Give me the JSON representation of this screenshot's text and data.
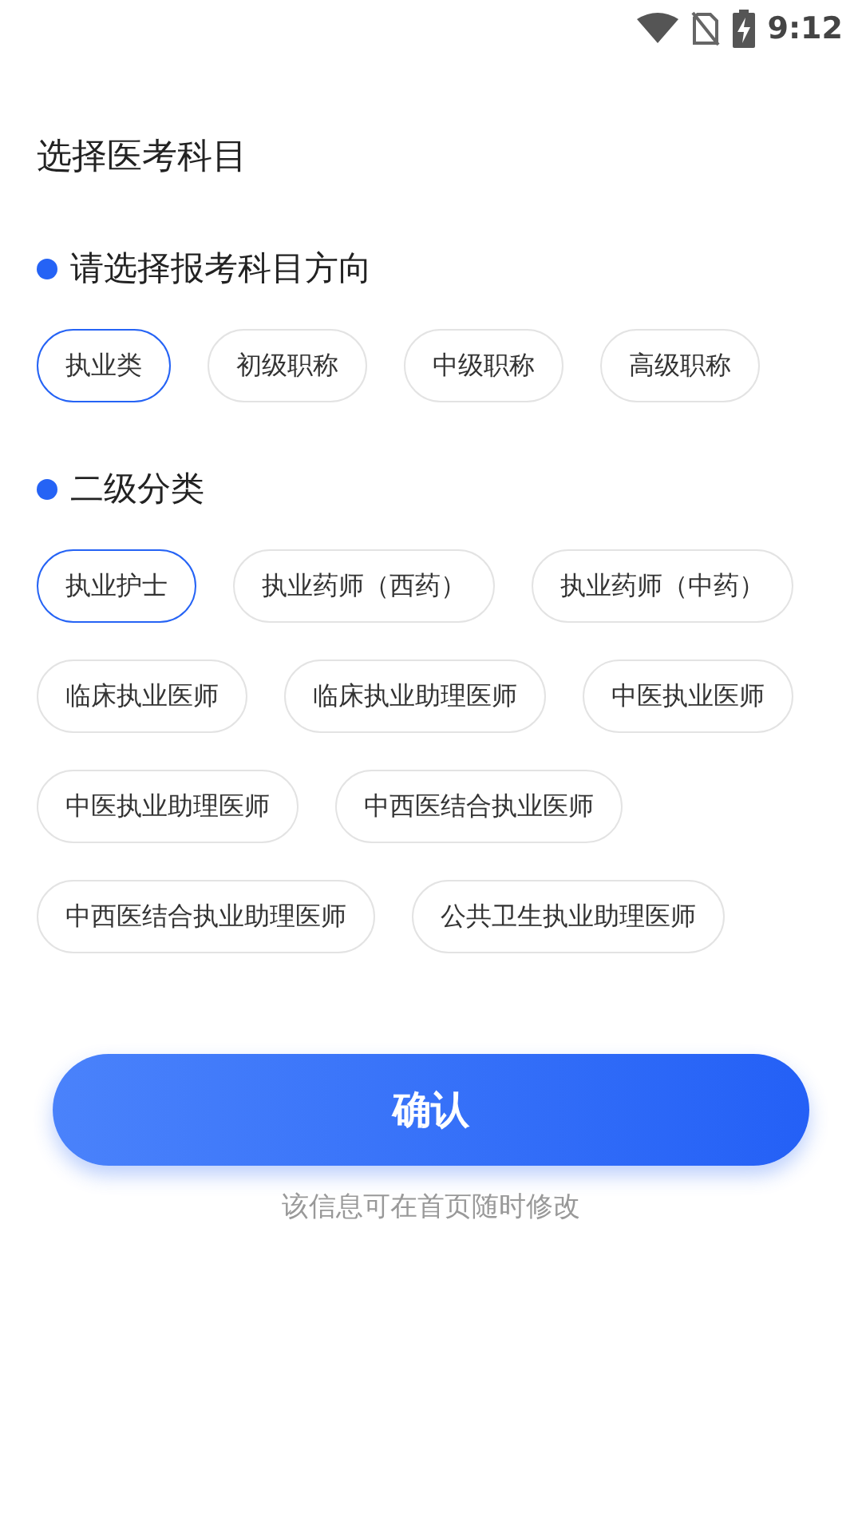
{
  "status_bar": {
    "time": "9:12"
  },
  "title": "选择医考科目",
  "sections": [
    {
      "heading": "请选择报考科目方向",
      "options": [
        {
          "label": "执业类",
          "selected": true
        },
        {
          "label": "初级职称",
          "selected": false
        },
        {
          "label": "中级职称",
          "selected": false
        },
        {
          "label": "高级职称",
          "selected": false
        }
      ]
    },
    {
      "heading": "二级分类",
      "options": [
        {
          "label": "执业护士",
          "selected": true
        },
        {
          "label": "执业药师（西药）",
          "selected": false
        },
        {
          "label": "执业药师（中药）",
          "selected": false
        },
        {
          "label": "临床执业医师",
          "selected": false
        },
        {
          "label": "临床执业助理医师",
          "selected": false
        },
        {
          "label": "中医执业医师",
          "selected": false
        },
        {
          "label": "中医执业助理医师",
          "selected": false
        },
        {
          "label": "中西医结合执业医师",
          "selected": false
        },
        {
          "label": "中西医结合执业助理医师",
          "selected": false
        },
        {
          "label": "公共卫生执业助理医师",
          "selected": false
        }
      ]
    }
  ],
  "confirm_button": "确认",
  "hint": "该信息可在首页随时修改"
}
